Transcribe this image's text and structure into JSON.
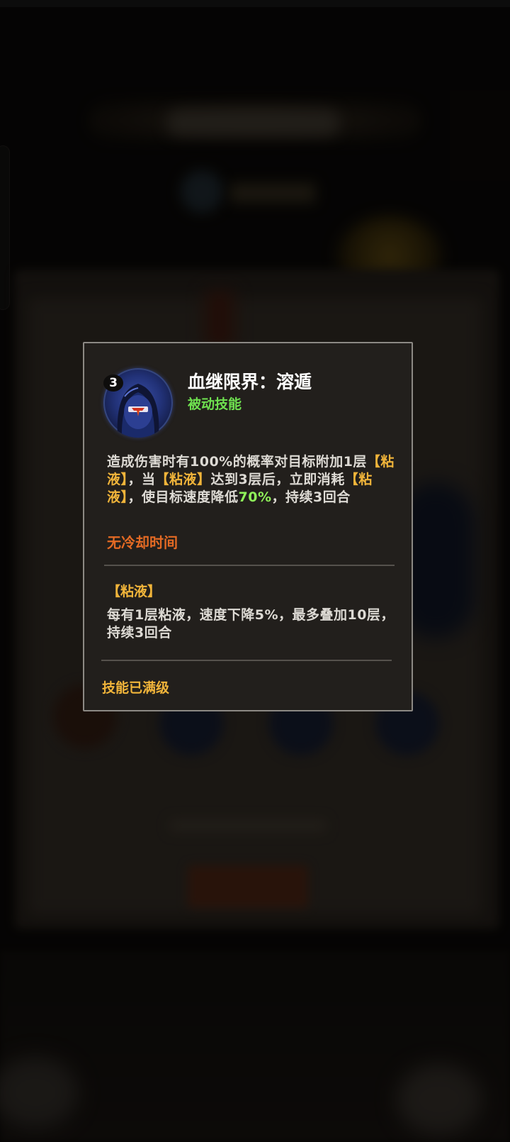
{
  "skill": {
    "level": "3",
    "name": "血继限界：溶遁",
    "type": "被动技能",
    "icon": "hooded-ninja-icon",
    "description": [
      {
        "text": "造成伤害时有100%的概率对目标附加1层",
        "style": "normal"
      },
      {
        "text": "【粘液】",
        "style": "keyword"
      },
      {
        "text": "，当",
        "style": "normal"
      },
      {
        "text": "【粘液】",
        "style": "keyword"
      },
      {
        "text": "达到3层后，立即消耗",
        "style": "normal"
      },
      {
        "text": "【粘液】",
        "style": "keyword"
      },
      {
        "text": "，使目标速度降低",
        "style": "normal"
      },
      {
        "text": "70%",
        "style": "highlight"
      },
      {
        "text": "，持续3回合",
        "style": "normal"
      }
    ],
    "cooldown": "无冷却时间",
    "effect": {
      "name": "【粘液】",
      "description": "每有1层粘液，速度下降5%，最多叠加10层，持续3回合"
    },
    "status": "技能已满级"
  },
  "colors": {
    "keyword": "#f0b43a",
    "highlight": "#8ff05a",
    "skill_type": "#6ee04f",
    "cooldown": "#e46a24",
    "text": "#dddad4",
    "card_bg": "#221f1c",
    "card_border": "#8c8984"
  }
}
